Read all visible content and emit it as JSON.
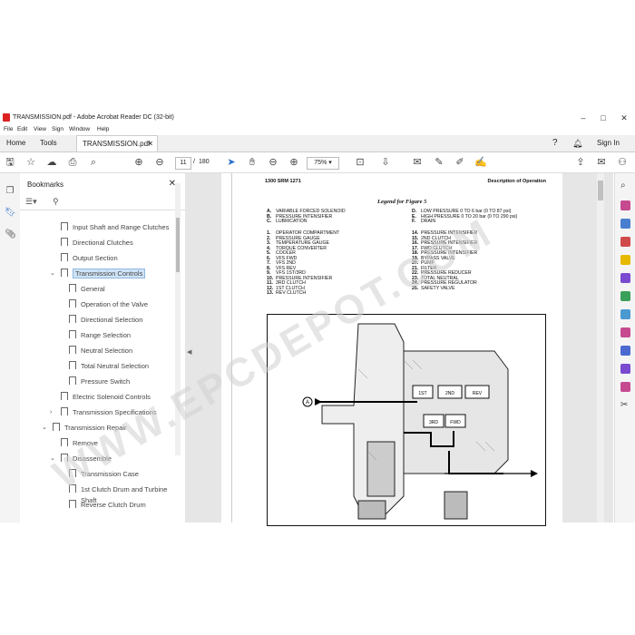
{
  "window": {
    "title": "TRANSMISSION.pdf - Adobe Acrobat Reader DC (32-bit)",
    "controls": [
      "–",
      "□",
      "✕"
    ]
  },
  "menu": [
    "File",
    "Edit",
    "View",
    "Sign",
    "Window",
    "Help"
  ],
  "tabs": {
    "home": "Home",
    "tools": "Tools",
    "document": "TRANSMISSION.pdf",
    "sign_in": "Sign In"
  },
  "toolbar": {
    "current_page": "11",
    "page_sep": "/",
    "total_pages": "180",
    "zoom": "75%"
  },
  "bookmarks": {
    "header": "Bookmarks",
    "items": [
      {
        "label": "Input Shaft and Range Clutches",
        "level": 1
      },
      {
        "label": "Directional Clutches",
        "level": 1
      },
      {
        "label": "Output Section",
        "level": 1
      },
      {
        "label": "Transmission Controls",
        "level": 1,
        "expanded": true,
        "selected": true
      },
      {
        "label": "General",
        "level": 2
      },
      {
        "label": "Operation of the Valve",
        "level": 2
      },
      {
        "label": "Directional Selection",
        "level": 2
      },
      {
        "label": "Range Selection",
        "level": 2
      },
      {
        "label": "Neutral Selection",
        "level": 2
      },
      {
        "label": "Total Neutral Selection",
        "level": 2
      },
      {
        "label": "Pressure Switch",
        "level": 2
      },
      {
        "label": "Electric Solenoid Controls",
        "level": 1
      },
      {
        "label": "Transmission Specifications",
        "level": 1,
        "collapsed": true
      },
      {
        "label": "Transmission Repair",
        "level": 0,
        "expanded": true
      },
      {
        "label": "Remove",
        "level": 1
      },
      {
        "label": "Disassemble",
        "level": 1,
        "expanded": true
      },
      {
        "label": "Transmission Case",
        "level": 2
      },
      {
        "label": "1st Clutch Drum and Turbine Shaft",
        "level": 2
      },
      {
        "label": "Reverse Clutch Drum",
        "level": 2
      }
    ]
  },
  "page": {
    "header_left": "1300 SRM 1271",
    "header_right": "Description of Operation",
    "legend_title": "Legend for Figure 5",
    "legend_letters_left": [
      {
        "k": "A.",
        "v": "VARIABLE FORCED SOLENOID"
      },
      {
        "k": "B.",
        "v": "PRESSURE INTENSIFIER"
      },
      {
        "k": "C.",
        "v": "LUBRICATION"
      }
    ],
    "legend_letters_right": [
      {
        "k": "D.",
        "v": "LOW PRESSURE 0 TO 6 bar (0 TO 87 psi)"
      },
      {
        "k": "E.",
        "v": "HIGH PRESSURE 0 TO 20 bar (0 TO 290 psi)"
      },
      {
        "k": "F.",
        "v": "DRAIN"
      }
    ],
    "legend_numbers_left": [
      {
        "k": "1.",
        "v": "OPERATOR COMPARTMENT"
      },
      {
        "k": "2.",
        "v": "PRESSURE GAUGE"
      },
      {
        "k": "3.",
        "v": "TEMPERATURE GAUGE"
      },
      {
        "k": "4.",
        "v": "TORQUE CONVERTER"
      },
      {
        "k": "5.",
        "v": "COOLER"
      },
      {
        "k": "6.",
        "v": "VFS FWD"
      },
      {
        "k": "7.",
        "v": "VFS 2ND"
      },
      {
        "k": "8.",
        "v": "VFS REV"
      },
      {
        "k": "9.",
        "v": "VFS 1ST/3RD"
      },
      {
        "k": "10.",
        "v": "PRESSURE INTENSIFIER"
      },
      {
        "k": "11.",
        "v": "3RD CLUTCH"
      },
      {
        "k": "12.",
        "v": "1ST CLUTCH"
      },
      {
        "k": "13.",
        "v": "REV CLUTCH"
      }
    ],
    "legend_numbers_right": [
      {
        "k": "14.",
        "v": "PRESSURE INTENSIFIER"
      },
      {
        "k": "15.",
        "v": "2ND CLUTCH"
      },
      {
        "k": "16.",
        "v": "PRESSURE INTENSIFIER"
      },
      {
        "k": "17.",
        "v": "FWD CLUTCH"
      },
      {
        "k": "18.",
        "v": "PRESSURE INTENSIFIER"
      },
      {
        "k": "19.",
        "v": "BYPASS VALVE"
      },
      {
        "k": "20.",
        "v": "PUMP"
      },
      {
        "k": "21.",
        "v": "FILTER"
      },
      {
        "k": "22.",
        "v": "PRESSURE REDUCER"
      },
      {
        "k": "23.",
        "v": "TOTAL NEUTRAL"
      },
      {
        "k": "24.",
        "v": "PRESSURE REGULATOR"
      },
      {
        "k": "25.",
        "v": "SAFETY VALVE"
      }
    ],
    "figure_labels": {
      "callout": "A",
      "c1": "1ST",
      "c2": "2ND",
      "c3": "REV",
      "c4": "3RD",
      "c5": "FWD"
    }
  },
  "watermark": "WWW.EPCDEPOT.COM",
  "colors": {
    "selection": "#cfe3f7",
    "accent_blue": "#2b6fc9",
    "pdf_red": "#d22222"
  }
}
